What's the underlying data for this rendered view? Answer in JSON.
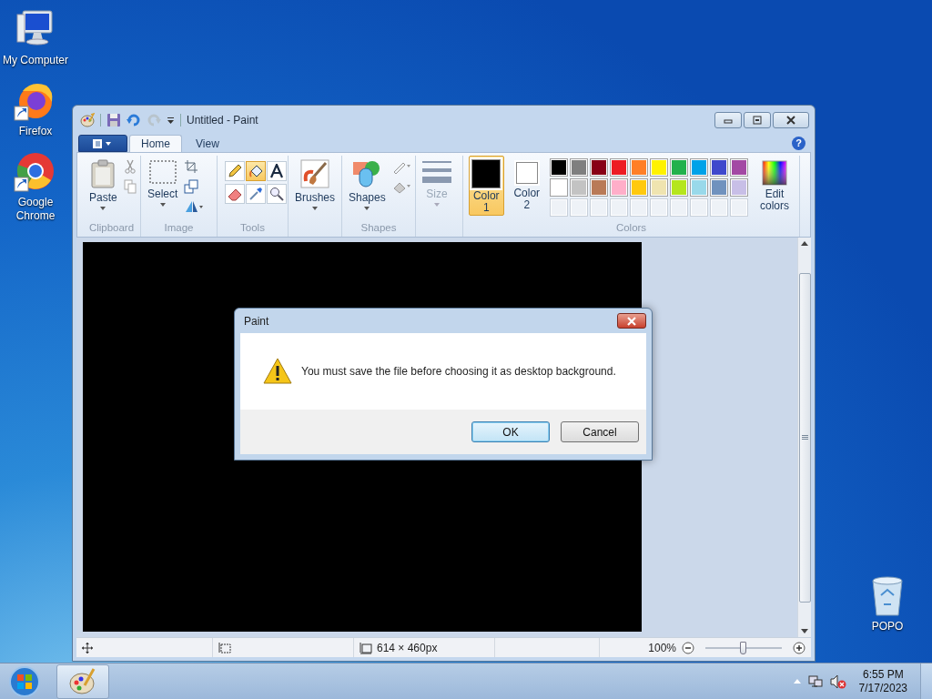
{
  "desktop_icons": [
    {
      "kind": "computer",
      "label": "My Computer",
      "shortcut": false
    },
    {
      "kind": "firefox",
      "label": "Firefox",
      "shortcut": true
    },
    {
      "kind": "chrome",
      "label": "Google Chrome",
      "shortcut": true
    },
    {
      "kind": "recycle",
      "label": "POPO",
      "shortcut": false
    }
  ],
  "paint": {
    "title": "Untitled - Paint",
    "tabs": [
      {
        "label": "Home",
        "selected": true
      },
      {
        "label": "View",
        "selected": false
      }
    ],
    "help": "?",
    "ribbon": {
      "clipboard": {
        "button": "Paste",
        "label": "Clipboard"
      },
      "image": {
        "button": "Select",
        "label": "Image"
      },
      "tools": {
        "label": "Tools",
        "items": [
          {
            "kind": "pencil",
            "selected": false
          },
          {
            "kind": "fill",
            "selected": true
          },
          {
            "kind": "text",
            "selected": false
          },
          {
            "kind": "eraser",
            "selected": false
          },
          {
            "kind": "picker",
            "selected": false
          },
          {
            "kind": "magnifier",
            "selected": false
          }
        ]
      },
      "brushes": {
        "button": "Brushes"
      },
      "shapes": {
        "button": "Shapes",
        "label": "Shapes"
      },
      "size": {
        "button": "Size",
        "disabled": true
      },
      "colors": {
        "label": "Colors",
        "slots": [
          {
            "label": "Color 1",
            "color": "#000000",
            "selected": true
          },
          {
            "label": "Color 2",
            "color": "#ffffff",
            "selected": false
          }
        ],
        "palette": [
          {
            "color": "#000000"
          },
          {
            "color": "#7f7f7f"
          },
          {
            "color": "#880015"
          },
          {
            "color": "#ed1c24"
          },
          {
            "color": "#ff7f27"
          },
          {
            "color": "#fff200"
          },
          {
            "color": "#22b14c"
          },
          {
            "color": "#00a2e8"
          },
          {
            "color": "#3f48cc"
          },
          {
            "color": "#a349a4"
          },
          {
            "color": "#ffffff"
          },
          {
            "color": "#c3c3c3"
          },
          {
            "color": "#b97a57"
          },
          {
            "color": "#ffaec9"
          },
          {
            "color": "#ffc90e"
          },
          {
            "color": "#efe4b0"
          },
          {
            "color": "#b5e61d"
          },
          {
            "color": "#99d9ea"
          },
          {
            "color": "#7092be"
          },
          {
            "color": "#c8bfe7"
          }
        ],
        "edit": "Edit colors"
      }
    },
    "status": {
      "canvas_size": "614 × 460px",
      "zoom": "100%",
      "zoom_slider": {
        "level": 0.5
      }
    }
  },
  "dialog": {
    "title": "Paint",
    "message": "You must save the file before choosing it as desktop background.",
    "buttons": [
      {
        "label": "OK",
        "default": true
      },
      {
        "label": "Cancel",
        "default": false
      }
    ]
  },
  "taskbar": {
    "time": "6:55 PM",
    "date": "7/17/2023"
  }
}
